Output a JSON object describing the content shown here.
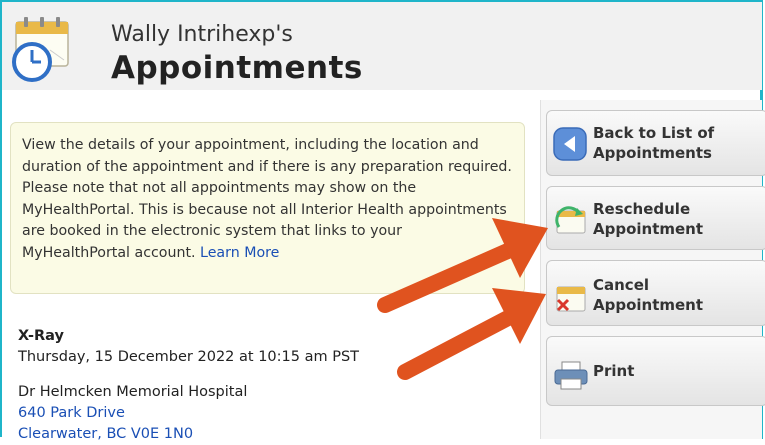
{
  "header": {
    "owner": "Wally Intrihexp's",
    "title": "Appointments"
  },
  "info": {
    "text": "View the details of your appointment, including the location and duration of the appointment and if there is any preparation required. Please note that not all appointments may show on the MyHealthPortal. This is because not all Interior Health appointments are booked in the electronic system that links to your MyHealthPortal account.",
    "link": "Learn More"
  },
  "appointment": {
    "type": "X-Ray",
    "datetime": "Thursday, 15 December 2022 at 10:15 am PST",
    "doctor": "Dr Helmcken Memorial Hospital",
    "address_line1": "640 Park Drive",
    "address_line2": "Clearwater, BC V0E 1N0"
  },
  "actions": {
    "back": "Back to List of Appointments",
    "reschedule": "Reschedule Appointment",
    "cancel": "Cancel Appointment",
    "print": "Print"
  },
  "icons": {
    "header": "calendar-clock-icon",
    "back": "back-arrow-icon",
    "reschedule": "calendar-refresh-icon",
    "cancel": "calendar-cancel-icon",
    "print": "printer-icon"
  },
  "colors": {
    "frame": "#1fb5c9",
    "link": "#1a4fb5",
    "annotation_arrow": "#e0531f"
  }
}
